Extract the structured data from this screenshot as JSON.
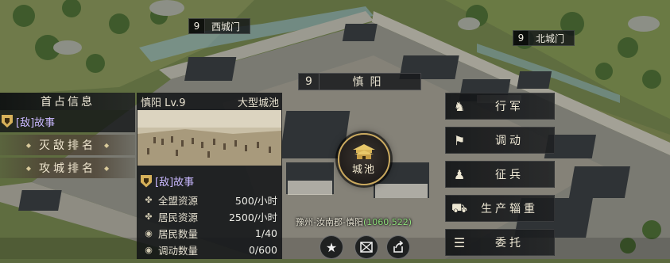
{
  "map_labels": {
    "west_gate": {
      "level": "9",
      "name": "西城门"
    },
    "north_gate": {
      "level": "9",
      "name": "北城门"
    }
  },
  "city_plate": {
    "level": "9",
    "name": "慎阳"
  },
  "first_occupy": {
    "title": "首占信息",
    "owner": "[敌]故事",
    "rank_buttons": [
      "灭敌排名",
      "攻城排名"
    ]
  },
  "city_info": {
    "name_level": "慎阳 Lv.9",
    "type": "大型城池",
    "owner": "[敌]故事",
    "stats": [
      {
        "icon": "alliance-resource-icon",
        "label": "全盟资源",
        "value": "500/小时"
      },
      {
        "icon": "resident-resource-icon",
        "label": "居民资源",
        "value": "2500/小时"
      },
      {
        "icon": "resident-count-icon",
        "label": "居民数量",
        "value": "1/40"
      },
      {
        "icon": "dispatch-count-icon",
        "label": "调动数量",
        "value": "0/600"
      }
    ]
  },
  "castle_button": {
    "label": "城池"
  },
  "location": {
    "path": "豫州-汝南郡-慎阳",
    "coords": "(1060,522)"
  },
  "bottom_buttons": [
    "star-icon",
    "mail-icon",
    "share-icon"
  ],
  "actions": [
    {
      "icon": "horse-icon",
      "label": "行军"
    },
    {
      "icon": "flag-icon",
      "label": "调动"
    },
    {
      "icon": "soldier-icon",
      "label": "征兵"
    },
    {
      "icon": "supply-cart-icon",
      "label": "生产辎重"
    },
    {
      "icon": "delegate-icon",
      "label": "委托"
    }
  ],
  "colors": {
    "enemy_owner": "#c9b8ff",
    "coord_highlight": "#8fe07c",
    "castle_ring": "#c9a85e"
  }
}
